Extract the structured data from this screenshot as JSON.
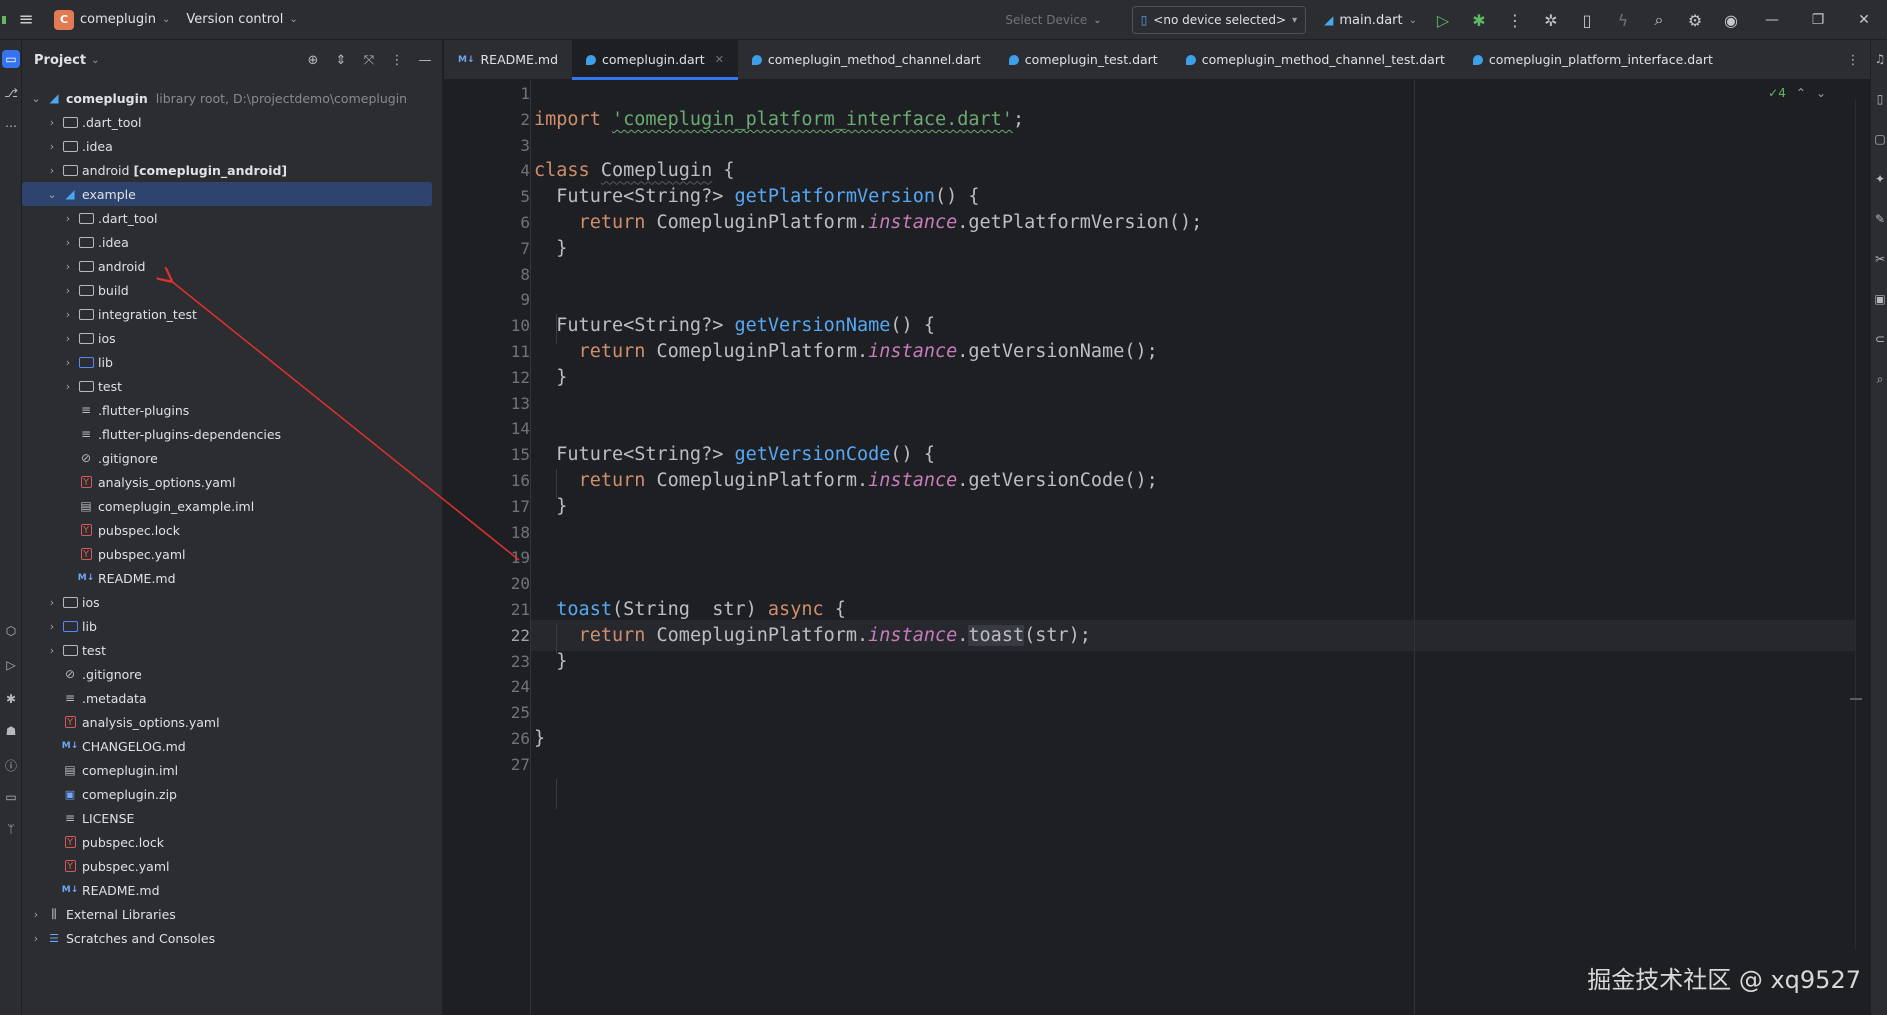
{
  "titlebar": {
    "project_badge": "C",
    "project_name": "comeplugin",
    "vcs": "Version control",
    "select_device": "Select Device",
    "device": "<no device selected>",
    "run_config": "main.dart"
  },
  "panel": {
    "title": "Project"
  },
  "tree": [
    {
      "depth": 0,
      "chev": "v",
      "icon": "flutter",
      "label": "comeplugin",
      "bold": true,
      "extra": "library root,  D:\\projectdemo\\comeplugin"
    },
    {
      "depth": 1,
      "chev": ">",
      "icon": "folder",
      "label": ".dart_tool"
    },
    {
      "depth": 1,
      "chev": ">",
      "icon": "folder",
      "label": ".idea"
    },
    {
      "depth": 1,
      "chev": ">",
      "icon": "folder",
      "label": "android",
      "bold_suffix": "[comeplugin_android]"
    },
    {
      "depth": 1,
      "chev": "v",
      "icon": "flutter",
      "label": "example",
      "selected": true
    },
    {
      "depth": 2,
      "chev": ">",
      "icon": "folder",
      "label": ".dart_tool"
    },
    {
      "depth": 2,
      "chev": ">",
      "icon": "folder",
      "label": ".idea"
    },
    {
      "depth": 2,
      "chev": ">",
      "icon": "folder",
      "label": "android"
    },
    {
      "depth": 2,
      "chev": ">",
      "icon": "folder",
      "label": "build"
    },
    {
      "depth": 2,
      "chev": ">",
      "icon": "folder",
      "label": "integration_test"
    },
    {
      "depth": 2,
      "chev": ">",
      "icon": "folder",
      "label": "ios"
    },
    {
      "depth": 2,
      "chev": ">",
      "icon": "folder-blue",
      "label": "lib"
    },
    {
      "depth": 2,
      "chev": ">",
      "icon": "folder",
      "label": "test"
    },
    {
      "depth": 2,
      "chev": "",
      "icon": "lines",
      "label": ".flutter-plugins"
    },
    {
      "depth": 2,
      "chev": "",
      "icon": "lines",
      "label": ".flutter-plugins-dependencies"
    },
    {
      "depth": 2,
      "chev": "",
      "icon": "ignore",
      "label": ".gitignore"
    },
    {
      "depth": 2,
      "chev": "",
      "icon": "yaml",
      "label": "analysis_options.yaml"
    },
    {
      "depth": 2,
      "chev": "",
      "icon": "iml",
      "label": "comeplugin_example.iml"
    },
    {
      "depth": 2,
      "chev": "",
      "icon": "yaml",
      "label": "pubspec.lock"
    },
    {
      "depth": 2,
      "chev": "",
      "icon": "yaml",
      "label": "pubspec.yaml"
    },
    {
      "depth": 2,
      "chev": "",
      "icon": "md",
      "label": "README.md"
    },
    {
      "depth": 1,
      "chev": ">",
      "icon": "folder",
      "label": "ios"
    },
    {
      "depth": 1,
      "chev": ">",
      "icon": "folder-blue",
      "label": "lib"
    },
    {
      "depth": 1,
      "chev": ">",
      "icon": "folder",
      "label": "test"
    },
    {
      "depth": 1,
      "chev": "",
      "icon": "ignore",
      "label": ".gitignore"
    },
    {
      "depth": 1,
      "chev": "",
      "icon": "lines",
      "label": ".metadata"
    },
    {
      "depth": 1,
      "chev": "",
      "icon": "yaml",
      "label": "analysis_options.yaml"
    },
    {
      "depth": 1,
      "chev": "",
      "icon": "md",
      "label": "CHANGELOG.md"
    },
    {
      "depth": 1,
      "chev": "",
      "icon": "iml",
      "label": "comeplugin.iml"
    },
    {
      "depth": 1,
      "chev": "",
      "icon": "zip",
      "label": "comeplugin.zip"
    },
    {
      "depth": 1,
      "chev": "",
      "icon": "lines",
      "label": "LICENSE"
    },
    {
      "depth": 1,
      "chev": "",
      "icon": "yaml",
      "label": "pubspec.lock"
    },
    {
      "depth": 1,
      "chev": "",
      "icon": "yaml",
      "label": "pubspec.yaml"
    },
    {
      "depth": 1,
      "chev": "",
      "icon": "md",
      "label": "README.md"
    },
    {
      "depth": 0,
      "chev": ">",
      "icon": "libs",
      "label": "External Libraries"
    },
    {
      "depth": 0,
      "chev": ">",
      "icon": "scratch",
      "label": "Scratches and Consoles"
    }
  ],
  "tabs": [
    {
      "label": "README.md",
      "icon": "md",
      "active": false
    },
    {
      "label": "comeplugin.dart",
      "icon": "dart",
      "active": true
    },
    {
      "label": "comeplugin_method_channel.dart",
      "icon": "dart",
      "active": false
    },
    {
      "label": "comeplugin_test.dart",
      "icon": "dart",
      "active": false
    },
    {
      "label": "comeplugin_method_channel_test.dart",
      "icon": "dart",
      "active": false
    },
    {
      "label": "comeplugin_platform_interface.dart",
      "icon": "dart",
      "active": false
    }
  ],
  "editor": {
    "inspection_count": "4",
    "current_line": 22,
    "line_numbers": [
      "1",
      "2",
      "3",
      "4",
      "5",
      "6",
      "7",
      "8",
      "9",
      "10",
      "11",
      "12",
      "13",
      "14",
      "15",
      "16",
      "17",
      "18",
      "19",
      "20",
      "21",
      "22",
      "23",
      "24",
      "25",
      "26",
      "27"
    ],
    "lines": [
      [],
      [
        [
          "kw",
          "import "
        ],
        [
          "str",
          "'comeplugin_platform_interface.dart'"
        ],
        [
          "p",
          ";"
        ]
      ],
      [],
      [
        [
          "kw",
          "class "
        ],
        [
          "cls",
          "Comeplugin"
        ],
        [
          "p",
          " {"
        ]
      ],
      [
        [
          "p",
          "  Future<String?> "
        ],
        [
          "fn",
          "getPlatformVersion"
        ],
        [
          "p",
          "() {"
        ]
      ],
      [
        [
          "p",
          "    "
        ],
        [
          "kw",
          "return "
        ],
        [
          "p",
          "ComepluginPlatform."
        ],
        [
          "inst",
          "instance"
        ],
        [
          "p",
          ".getPlatformVersion();"
        ]
      ],
      [
        [
          "p",
          "  }"
        ]
      ],
      [],
      [],
      [
        [
          "p",
          "  Future<String?> "
        ],
        [
          "fn",
          "getVersionName"
        ],
        [
          "p",
          "() {"
        ]
      ],
      [
        [
          "p",
          "    "
        ],
        [
          "kw",
          "return "
        ],
        [
          "p",
          "ComepluginPlatform."
        ],
        [
          "inst",
          "instance"
        ],
        [
          "p",
          ".getVersionName();"
        ]
      ],
      [
        [
          "p",
          "  }"
        ]
      ],
      [],
      [],
      [
        [
          "p",
          "  Future<String?> "
        ],
        [
          "fn",
          "getVersionCode"
        ],
        [
          "p",
          "() {"
        ]
      ],
      [
        [
          "p",
          "    "
        ],
        [
          "kw",
          "return "
        ],
        [
          "p",
          "ComepluginPlatform."
        ],
        [
          "inst",
          "instance"
        ],
        [
          "p",
          ".getVersionCode();"
        ]
      ],
      [
        [
          "p",
          "  }"
        ]
      ],
      [],
      [],
      [],
      [
        [
          "p",
          "  "
        ],
        [
          "fn",
          "toast"
        ],
        [
          "p",
          "(String  str) "
        ],
        [
          "kw",
          "async"
        ],
        [
          "p",
          " {"
        ]
      ],
      [
        [
          "p",
          "    "
        ],
        [
          "kw",
          "return "
        ],
        [
          "p",
          "ComepluginPlatform."
        ],
        [
          "inst",
          "instance"
        ],
        [
          "p",
          "."
        ],
        [
          "hl",
          "toast"
        ],
        [
          "p",
          "(str);"
        ]
      ],
      [
        [
          "p",
          "  }"
        ]
      ],
      [],
      [],
      [
        [
          "p",
          "}"
        ]
      ],
      []
    ]
  },
  "watermark": "掘金技术社区 @ xq9527"
}
